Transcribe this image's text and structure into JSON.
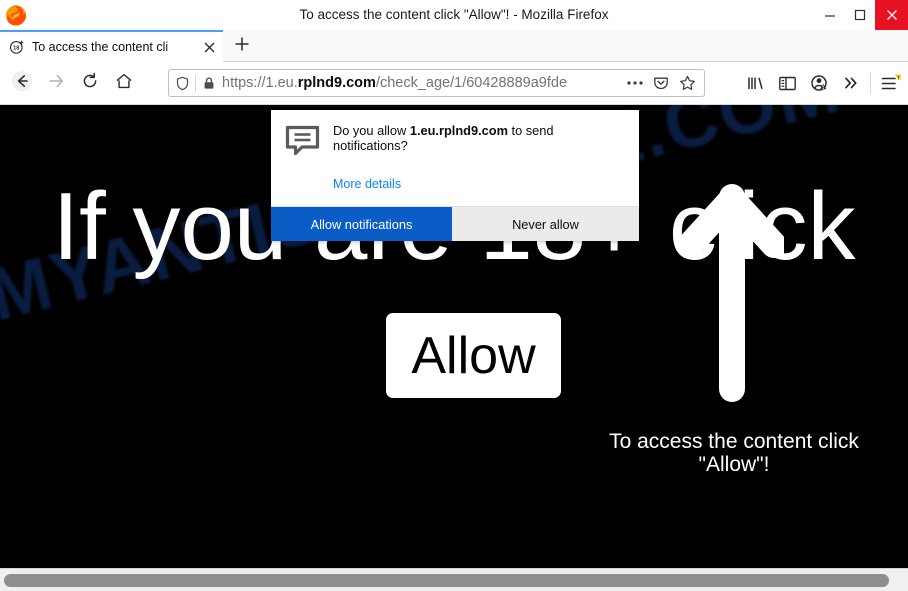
{
  "window": {
    "title": "To access the content click \"Allow\"! - Mozilla Firefox",
    "logo_icon": "firefox-logo",
    "minimize_icon": "minimize-icon",
    "maximize_icon": "maximize-icon",
    "close_icon": "close-icon",
    "close_button_color": "#e81123"
  },
  "tabs": {
    "active": {
      "favicon": "age-18-plus-icon",
      "title": "To access the content cli",
      "close_icon": "tab-close-icon"
    },
    "new_tab_icon": "plus-icon"
  },
  "toolbar": {
    "back_icon": "back-arrow-icon",
    "forward_icon": "forward-arrow-icon",
    "reload_icon": "reload-icon",
    "home_icon": "home-icon",
    "url": {
      "shield_icon": "tracking-protection-shield-icon",
      "lock_icon": "padlock-icon",
      "scheme": "https://1.eu.",
      "domain": "rplnd9.com",
      "path": "/check_age/1/60428889a9fde",
      "full": "https://1.eu.rplnd9.com/check_age/1/60428889a9fde",
      "page_actions_icon": "ellipsis-icon",
      "pocket_icon": "pocket-icon",
      "bookmark_icon": "star-icon"
    },
    "library_icon": "library-icon",
    "sidebar_icon": "sidebar-icon",
    "account_icon": "account-warning-icon",
    "overflow_icon": "double-chevron-right-icon",
    "menu_icon": "hamburger-menu-icon",
    "menu_badge_color": "#ffbf00"
  },
  "notification_popup": {
    "icon": "speech-bubble-notification-icon",
    "message_prefix": "Do you allow ",
    "origin": "1.eu.rplnd9.com",
    "message_suffix": " to send notifications?",
    "more_details_label": "More details",
    "allow_label": "Allow notifications",
    "never_label": "Never allow",
    "allow_color": "#0a5dc7"
  },
  "page": {
    "background_color": "#000000",
    "watermark": "MYANTISPYWARE.COM",
    "headline": "If you are 18+ click",
    "allow_button_label": "Allow",
    "arrow_icon": "up-arrow-icon",
    "footer_line1": "To access the content click",
    "footer_line2": "\"Allow\"!"
  },
  "scrollbar": {
    "horizontal_thumb": "horizontal-scrollbar-thumb"
  }
}
